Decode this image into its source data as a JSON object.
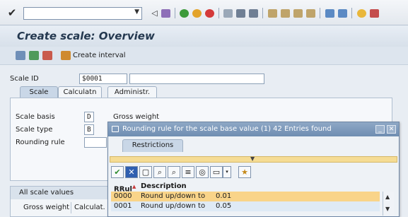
{
  "toolbar": {
    "command_field_value": ""
  },
  "page": {
    "title": "Create scale: Overview"
  },
  "app_toolbar": {
    "create_interval_label": "Create interval"
  },
  "header": {
    "scale_id_label": "Scale ID",
    "scale_id_value": "$0001",
    "description_value": ""
  },
  "tabs": [
    {
      "label": "Scale",
      "active": true
    },
    {
      "label": "Calculatn",
      "active": false
    },
    {
      "label": "Administr.",
      "active": false
    }
  ],
  "scale_tab": {
    "scale_basis_label": "Scale basis",
    "scale_basis_value": "D",
    "scale_basis_text": "Gross weight",
    "scale_type_label": "Scale type",
    "scale_type_value": "B",
    "rounding_rule_label": "Rounding rule",
    "rounding_rule_value": ""
  },
  "all_scale_values": {
    "title": "All scale values",
    "columns": [
      "Gross weight",
      "Calculat. t"
    ]
  },
  "popup": {
    "title": "Rounding rule for the scale base value (1)   42 Entries found",
    "restrictions_tab": "Restrictions",
    "columns": [
      "RRul",
      "Description"
    ],
    "rows": [
      {
        "code": "0000",
        "description": "Round up/down to",
        "value": "0.01",
        "selected": true
      },
      {
        "code": "0001",
        "description": "Round up/down to",
        "value": "0.05",
        "selected": false
      }
    ]
  },
  "colors": {
    "title_bar": "#6f8db1",
    "selected_row": "#f9d489",
    "alt_row": "#dfeaf5",
    "accent_yellow": "#f5dc94"
  },
  "icons": [
    "enter-check-icon",
    "save-icon",
    "back-icon",
    "exit-icon",
    "cancel-icon",
    "print-icon",
    "find-icon",
    "find-next-icon",
    "first-page-icon",
    "previous-page-icon",
    "next-page-icon",
    "last-page-icon",
    "create-session-icon",
    "shortcut-icon",
    "help-icon",
    "customize-layout-icon"
  ]
}
